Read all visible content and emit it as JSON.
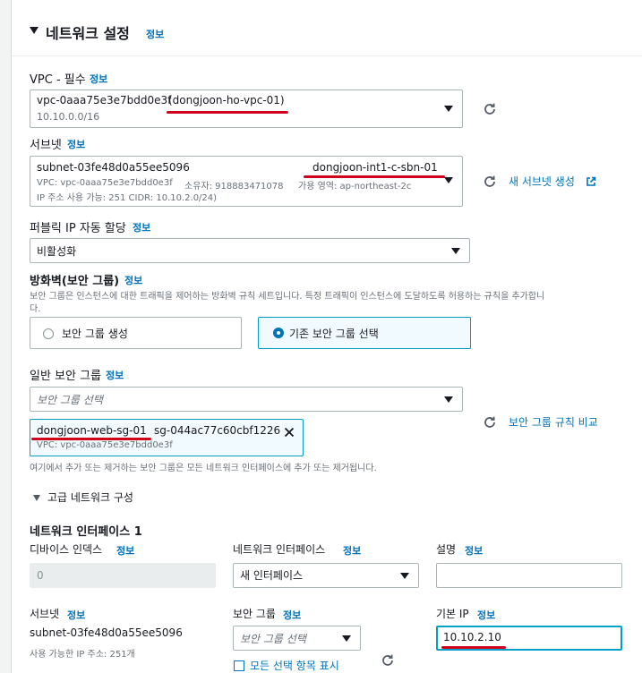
{
  "section": {
    "title": "네트워크 설정",
    "info": "정보"
  },
  "vpc": {
    "label": "VPC - 필수",
    "info": "정보",
    "value": "vpc-0aaa75e3e7bdd0e3f",
    "name": "(dongjoon-ho-vpc-01)",
    "cidr": "10.10.0.0/16"
  },
  "subnet": {
    "label": "서브넷",
    "info": "정보",
    "value": "subnet-03fe48d0a55ee5096",
    "name": "dongjoon-int1-c-sbn-01",
    "line2a": "VPC: vpc-0aaa75e3e7bdd0e3f",
    "line2b": "소유자: 918883471078",
    "line2c": "가용 영역: ap-northeast-2c",
    "line3": "IP 주소 사용 가능: 251    CIDR: 10.10.2.0/24)",
    "create_link": "새 서브넷 생성"
  },
  "public_ip": {
    "label": "퍼블릭 IP 자동 할당",
    "info": "정보",
    "value": "비활성화"
  },
  "firewall": {
    "label": "방화벽(보안 그룹)",
    "info": "정보",
    "description": "보안 그룹은 인스턴스에 대한 트래픽을 제어하는 방화벽 규칙 세트입니다. 특정 트래픽이 인스턴스에 도달하도록 허용하는 규칙을 추가합니다.",
    "desc_line1": "보안 그룹은 인스턴스에 대한 트래픽을 제어하는 방화벽 규칙 세트입니다. 특정 트래픽이 인스턴스에 도달하도록 허용하는 규칙을 추가합니",
    "desc_line2": "다.",
    "option_create": "보안 그룹 생성",
    "option_existing": "기존 보안 그룹 선택"
  },
  "common_sg": {
    "label": "일반 보안 그룹",
    "info": "정보",
    "placeholder": "보안 그룹 선택",
    "token_name": "dongjoon-web-sg-01",
    "token_id": "sg-044ac77c60cbf1226",
    "token_vpc": "VPC: vpc-0aaa75e3e7bdd0e3f",
    "compare_link": "보안 그룹 규칙 비교",
    "hint": "여기에서 추가 또는 제거하는 보안 그룹은 모든 네트워크 인터페이스에 추가 또는 제거됩니다."
  },
  "advanced": {
    "title": "고급 네트워크 구성"
  },
  "ni": {
    "title": "네트워크 인터페이스 1",
    "device_index": {
      "label": "디바이스 인덱스",
      "info": "정보",
      "value": "0"
    },
    "interface": {
      "label": "네트워크 인터페이스",
      "info": "정보",
      "value": "새 인터페이스"
    },
    "description": {
      "label": "설명",
      "info": "정보",
      "value": ""
    },
    "subnet": {
      "label": "서브넷",
      "info": "정보",
      "value": "subnet-03fe48d0a55ee5096",
      "sub": "사용 가능한 IP 주소: 251개"
    },
    "sg": {
      "label": "보안 그룹",
      "info": "정보",
      "placeholder": "보안 그룹 선택",
      "show_all": "모든 선택 항목 표시"
    },
    "primary_ip": {
      "label": "기본 IP",
      "info": "정보",
      "value": "10.10.2.10"
    }
  }
}
